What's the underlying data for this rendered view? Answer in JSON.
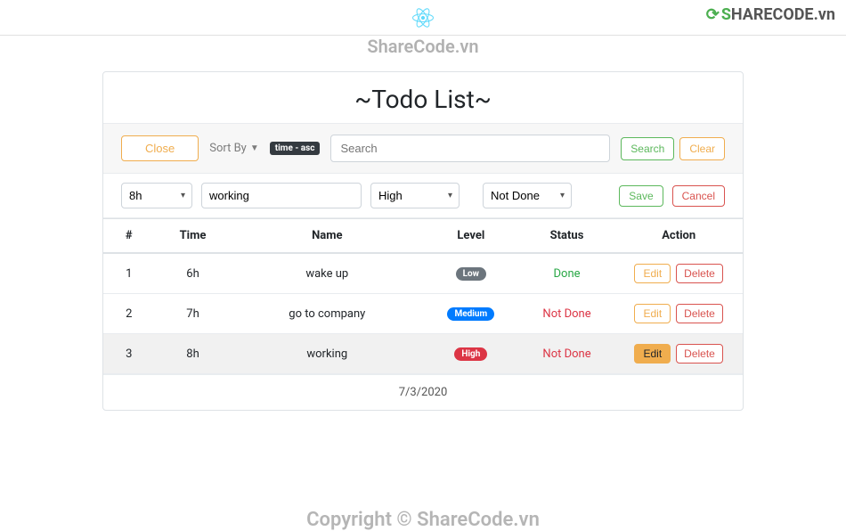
{
  "watermark_top": "ShareCode.vn",
  "logo_brand": {
    "s": "S",
    "rest": "HARECODE",
    "tld": ".vn"
  },
  "title": "~Todo List~",
  "toolbar": {
    "close_label": "Close",
    "sortby_label": "Sort By",
    "sort_badge": "time - asc",
    "search_placeholder": "Search",
    "search_value": "",
    "search_label": "Search",
    "clear_label": "Clear"
  },
  "edit_row": {
    "time_value": "8h",
    "name_value": "working",
    "level_value": "High",
    "status_value": "Not Done",
    "save_label": "Save",
    "cancel_label": "Cancel"
  },
  "columns": {
    "index": "#",
    "time": "Time",
    "name": "Name",
    "level": "Level",
    "status": "Status",
    "action": "Action"
  },
  "rows": [
    {
      "index": "1",
      "time": "6h",
      "name": "wake up",
      "level": "Low",
      "level_class": "badge-low",
      "status": "Done",
      "status_class": "status-done",
      "active": false
    },
    {
      "index": "2",
      "time": "7h",
      "name": "go to company",
      "level": "Medium",
      "level_class": "badge-medium",
      "status": "Not Done",
      "status_class": "status-notdone",
      "active": false
    },
    {
      "index": "3",
      "time": "8h",
      "name": "working",
      "level": "High",
      "level_class": "badge-high",
      "status": "Not Done",
      "status_class": "status-notdone",
      "active": true
    }
  ],
  "actions": {
    "edit_label": "Edit",
    "delete_label": "Delete"
  },
  "footer_date": "7/3/2020",
  "copyright": "Copyright © ShareCode.vn"
}
